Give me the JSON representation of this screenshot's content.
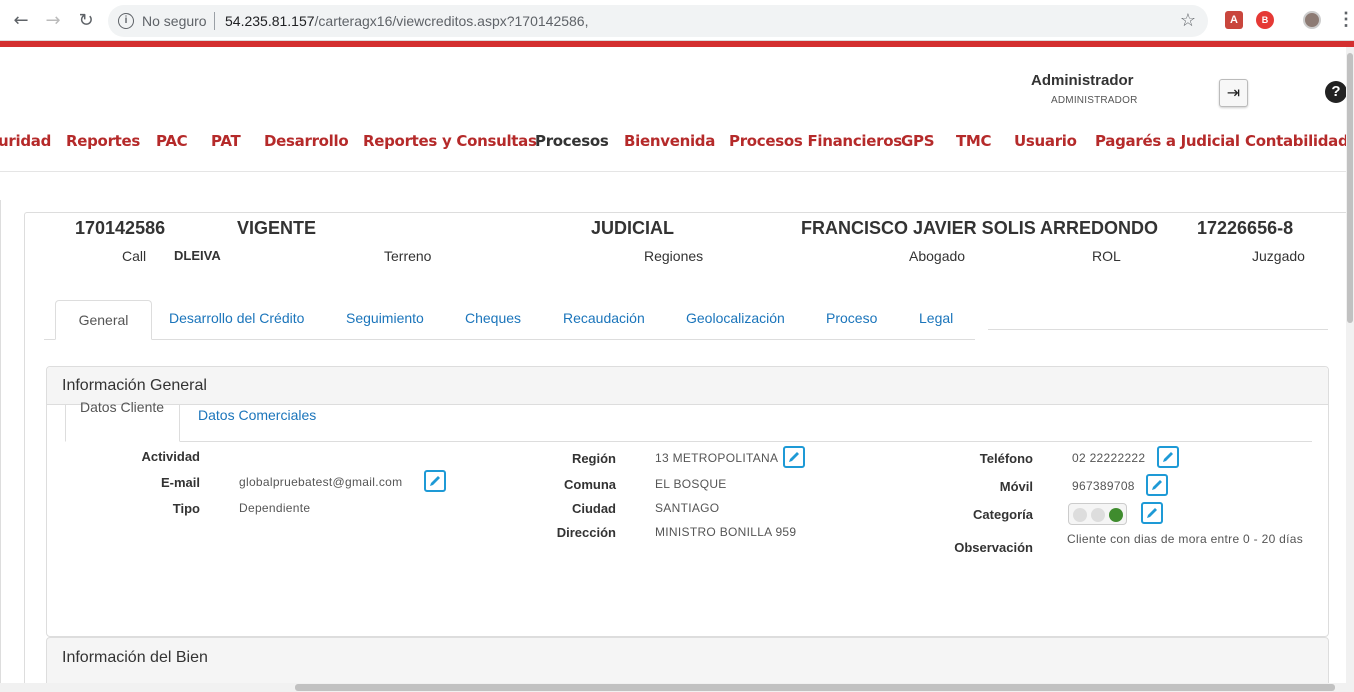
{
  "browser": {
    "security": "No seguro",
    "url_host": "54.235.81.157",
    "url_path": "/carteragx16/viewcreditos.aspx?170142586,"
  },
  "header": {
    "user_name": "Administrador",
    "user_role": "ADMINISTRADOR"
  },
  "menu": {
    "items": [
      "uridad",
      "Reportes",
      "PAC",
      "PAT",
      "Desarrollo",
      "Reportes y Consultas",
      "Procesos",
      "Bienvenida",
      "Procesos Financieros",
      "GPS",
      "TMC",
      "Usuario",
      "Pagarés a Judicial",
      "Contabilidad"
    ]
  },
  "credit": {
    "number": "170142586",
    "status": "VIGENTE",
    "stage": "JUDICIAL",
    "client_name": "FRANCISCO JAVIER SOLIS ARREDONDO",
    "rut": "17226656-8",
    "call_label": "Call",
    "call_value": "DLEIVA",
    "terreno_label": "Terreno",
    "regiones_label": "Regiones",
    "abogado_label": "Abogado",
    "rol_label": "ROL",
    "juzgado_label": "Juzgado"
  },
  "tabs": [
    "General",
    "Desarrollo del Crédito",
    "Seguimiento",
    "Cheques",
    "Recaudación",
    "Geolocalización",
    "Proceso",
    "Legal"
  ],
  "info_general": {
    "title": "Información General",
    "subtabs": [
      "Datos Cliente",
      "Datos Comerciales"
    ],
    "fields": {
      "actividad_label": "Actividad",
      "email_label": "E-mail",
      "email_value": "globalpruebatest@gmail.com",
      "tipo_label": "Tipo",
      "tipo_value": "Dependiente",
      "region_label": "Región",
      "region_value": "13 METROPOLITANA",
      "comuna_label": "Comuna",
      "comuna_value": "EL BOSQUE",
      "ciudad_label": "Ciudad",
      "ciudad_value": "SANTIAGO",
      "direccion_label": "Dirección",
      "direccion_value": "MINISTRO BONILLA 959",
      "telefono_label": "Teléfono",
      "telefono_value": "02 22222222",
      "movil_label": "Móvil",
      "movil_value": "967389708",
      "categoria_label": "Categoría",
      "categoria_level": "green",
      "observacion_label": "Observación",
      "observacion_value": "Cliente con dias de mora entre 0 - 20 días"
    }
  },
  "info_bien": {
    "title": "Información del Bien"
  },
  "colors": {
    "brand_red": "#d32f2f",
    "menu_red": "#b52a2a",
    "link_blue": "#1b75bb",
    "edit_blue": "#1e9ad6",
    "status_green": "#3f8c2e"
  }
}
